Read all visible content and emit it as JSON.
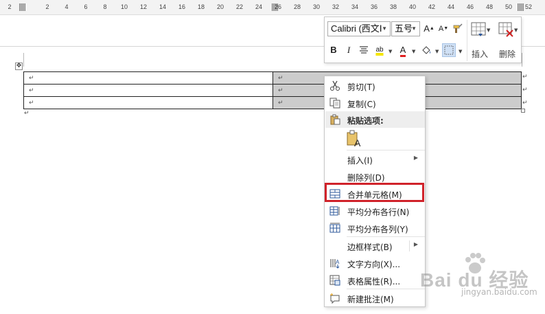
{
  "ruler": {
    "ticks": [
      "2",
      "4",
      "6",
      "8",
      "10",
      "12",
      "14",
      "16",
      "18",
      "20",
      "22",
      "24",
      "26",
      "28",
      "30",
      "32",
      "34",
      "36",
      "38",
      "40",
      "42",
      "44",
      "46",
      "48",
      "50",
      "52"
    ]
  },
  "table": {
    "rows": [
      {
        "left": "↵",
        "right": "↵",
        "end": "↵"
      },
      {
        "left": "↵",
        "right": "↵",
        "end": "↵"
      },
      {
        "left": "↵",
        "right": "↵",
        "end": "↵"
      }
    ],
    "handle_glyph": "✥",
    "after_mark": "↵"
  },
  "mini_toolbar": {
    "font_name": "Calibri (西文Ⅰ",
    "font_size": "五号",
    "grow_font": "A",
    "shrink_font": "A",
    "bold": "B",
    "italic": "I",
    "font_color_glyph": "A",
    "highlight_glyph": "ab",
    "insert_label": "插入",
    "delete_label": "删除",
    "colors": {
      "highlight": "#f5e600",
      "font_color": "#e02020",
      "accent": "#2b579a"
    }
  },
  "context_menu": {
    "items": [
      {
        "label": "剪切(T)",
        "icon": "scissors-icon"
      },
      {
        "label": "复制(C)",
        "icon": "copy-icon"
      },
      {
        "label": "粘贴选项:",
        "icon": "paste-icon"
      },
      {
        "label": "",
        "icon": "paste-keep-text-icon"
      },
      {
        "label": "插入(I)",
        "icon": ""
      },
      {
        "label": "删除列(D)",
        "icon": ""
      },
      {
        "label": "合并单元格(M)",
        "icon": "merge-cells-icon"
      },
      {
        "label": "平均分布各行(N)",
        "icon": "distribute-rows-icon"
      },
      {
        "label": "平均分布各列(Y)",
        "icon": "distribute-columns-icon"
      },
      {
        "label": "边框样式(B)",
        "icon": ""
      },
      {
        "label": "文字方向(X)...",
        "icon": "text-direction-icon"
      },
      {
        "label": "表格属性(R)...",
        "icon": "table-properties-icon"
      },
      {
        "label": "新建批注(M)",
        "icon": "new-comment-icon"
      }
    ],
    "highlight_color": "#d0222a"
  },
  "watermark": {
    "brand": "Bai du 经验",
    "site": "jingyan.baidu.com"
  }
}
